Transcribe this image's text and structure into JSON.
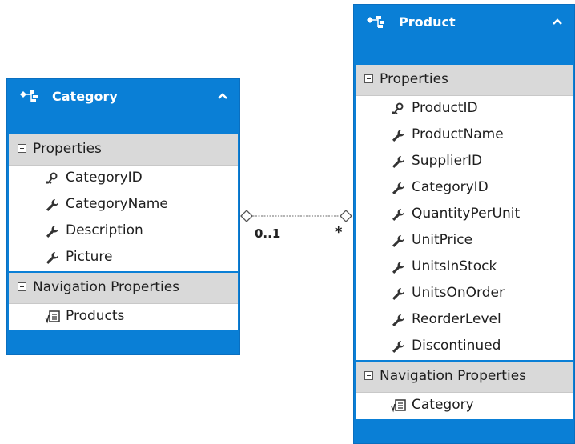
{
  "category": {
    "title": "Category",
    "properties_label": "Properties",
    "properties": [
      {
        "name": "CategoryID",
        "icon": "key-icon"
      },
      {
        "name": "CategoryName",
        "icon": "wrench-icon"
      },
      {
        "name": "Description",
        "icon": "wrench-icon"
      },
      {
        "name": "Picture",
        "icon": "wrench-icon"
      }
    ],
    "nav_label": "Navigation Properties",
    "navigation": [
      {
        "name": "Products",
        "icon": "navigation-property-icon"
      }
    ]
  },
  "product": {
    "title": "Product",
    "properties_label": "Properties",
    "properties": [
      {
        "name": "ProductID",
        "icon": "key-icon"
      },
      {
        "name": "ProductName",
        "icon": "wrench-icon"
      },
      {
        "name": "SupplierID",
        "icon": "wrench-icon"
      },
      {
        "name": "CategoryID",
        "icon": "wrench-icon"
      },
      {
        "name": "QuantityPerUnit",
        "icon": "wrench-icon"
      },
      {
        "name": "UnitPrice",
        "icon": "wrench-icon"
      },
      {
        "name": "UnitsInStock",
        "icon": "wrench-icon"
      },
      {
        "name": "UnitsOnOrder",
        "icon": "wrench-icon"
      },
      {
        "name": "ReorderLevel",
        "icon": "wrench-icon"
      },
      {
        "name": "Discontinued",
        "icon": "wrench-icon"
      }
    ],
    "nav_label": "Navigation Properties",
    "navigation": [
      {
        "name": "Category",
        "icon": "navigation-property-icon"
      }
    ]
  },
  "association": {
    "left_multiplicity": "0..1",
    "right_multiplicity": "*"
  },
  "colors": {
    "header": "#0a7fd6",
    "section": "#d9d9d9"
  }
}
